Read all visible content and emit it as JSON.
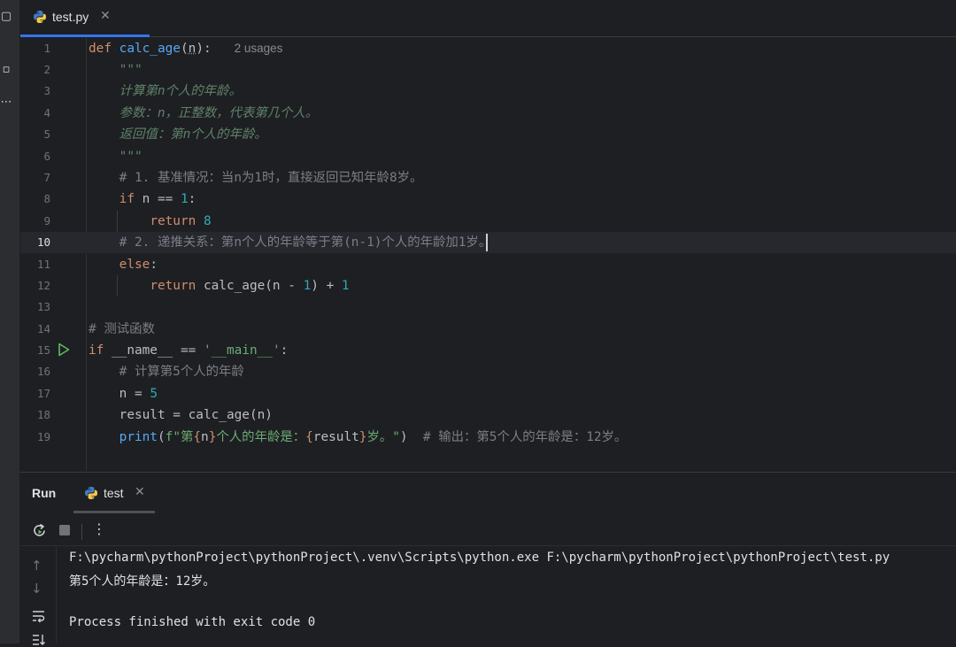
{
  "editor_tab": {
    "label": "test.py",
    "close": "✕"
  },
  "line_numbers": [
    "1",
    "2",
    "3",
    "4",
    "5",
    "6",
    "7",
    "8",
    "9",
    "10",
    "11",
    "12",
    "13",
    "14",
    "15",
    "16",
    "17",
    "18",
    "19"
  ],
  "code": {
    "l1": {
      "kw": "def ",
      "fn": "calc_age",
      "open": "(",
      "param": "n",
      "close": "):",
      "hint": "2 usages"
    },
    "l2": "\"\"\"",
    "l3": "计算第n个人的年龄。",
    "l4": "参数：n，正整数，代表第几个人。",
    "l5": "返回值：第n个人的年龄。",
    "l6": "\"\"\"",
    "l7": "# 1. 基准情况：当n为1时，直接返回已知年龄8岁。",
    "l8": {
      "kw": "if",
      "mid": " n == ",
      "num": "1",
      "end": ":"
    },
    "l9": {
      "kw": "return",
      "num": "8"
    },
    "l10": "# 2. 递推关系：第n个人的年龄等于第(n-1)个人的年龄加1岁。",
    "l11": {
      "kw": "else",
      "end": ":"
    },
    "l12": {
      "kw": "return",
      "mid": " calc_age(n - ",
      "num1": "1",
      "mid2": ") + ",
      "num2": "1"
    },
    "l14": "# 测试函数",
    "l15": {
      "kw": "if",
      "mid": " __name__ == ",
      "str": "'__main__'",
      "end": ":"
    },
    "l16": "# 计算第5个人的年龄",
    "l17": {
      "mid": "n = ",
      "num": "5"
    },
    "l18": "result = calc_age(n)",
    "l19": {
      "fn": "print",
      "open": "(",
      "fstr1": "f\"第",
      "lb1": "{",
      "var1": "n",
      "rb1": "}",
      "fstr2": "个人的年龄是：",
      "lb2": "{",
      "var2": "result",
      "rb2": "}",
      "fstr3": "岁。\"",
      "close": ")",
      "comment": "# 输出：第5个人的年龄是：12岁。"
    }
  },
  "run_panel": {
    "title": "Run",
    "tab_label": "test",
    "close": "✕",
    "more": "⋮",
    "console": {
      "line1": "F:\\pycharm\\pythonProject\\pythonProject\\.venv\\Scripts\\python.exe F:\\pycharm\\pythonProject\\pythonProject\\test.py",
      "line2": "第5个人的年龄是：12岁。",
      "line3": "Process finished with exit code 0"
    }
  },
  "colors": {
    "background": "#1e1f22",
    "keyword": "#cf8e6d",
    "function": "#56a8f5",
    "number": "#2aacb8",
    "string": "#6aab73",
    "docstring": "#5f826b",
    "comment": "#7a7e85",
    "accent": "#3574f0"
  },
  "icons": [
    "python-file-icon",
    "run-gutter-icon",
    "rerun-icon",
    "stop-icon",
    "more-icon",
    "scroll-up-icon",
    "scroll-down-icon",
    "soft-wrap-icon",
    "scroll-to-end-icon"
  ]
}
